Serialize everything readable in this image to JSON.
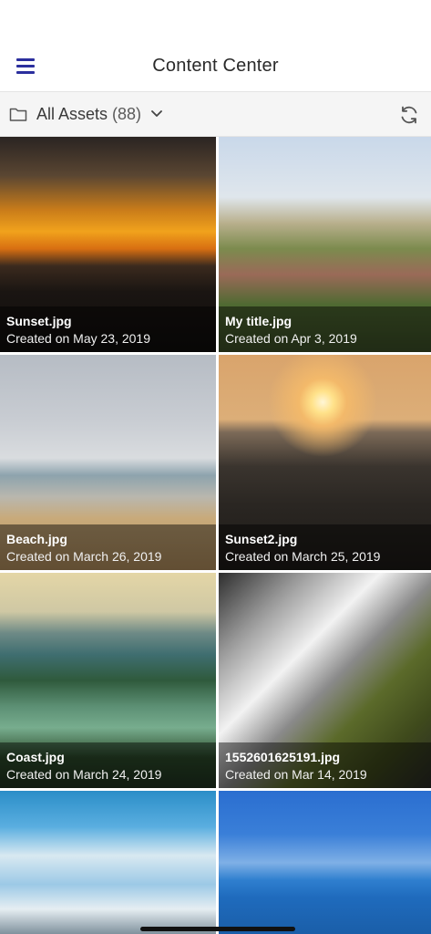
{
  "header": {
    "title": "Content Center"
  },
  "asset_bar": {
    "label": "All Assets",
    "count": "(88)"
  },
  "assets": [
    {
      "name": "Sunset.jpg",
      "date": "Created on May 23, 2019"
    },
    {
      "name": "My title.jpg",
      "date": "Created on Apr 3, 2019"
    },
    {
      "name": "Beach.jpg",
      "date": "Created on March 26, 2019"
    },
    {
      "name": "Sunset2.jpg",
      "date": "Created on March 25, 2019"
    },
    {
      "name": "Coast.jpg",
      "date": "Created on March 24, 2019"
    },
    {
      "name": "1552601625191.jpg",
      "date": "Created on Mar 14, 2019"
    }
  ],
  "colors": {
    "accent": "#2b2f9e"
  },
  "icons": {
    "menu": "hamburger-icon",
    "folder": "folder-icon",
    "dropdown": "chevron-down-icon",
    "refresh": "refresh-icon"
  }
}
